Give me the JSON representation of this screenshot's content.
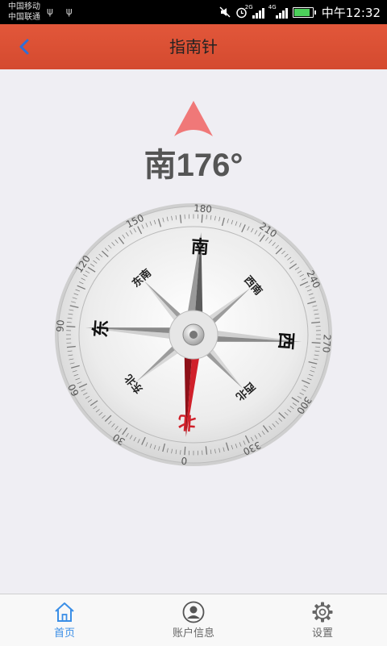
{
  "status_bar": {
    "carrier_1": "中国移动",
    "carrier_2": "中国联通",
    "usb_icons": "ψ ψ",
    "net_1": "2G",
    "net_2": "4G",
    "time": "中午12:32"
  },
  "header": {
    "title": "指南针",
    "back_icon": "chevron-left-icon"
  },
  "heading": {
    "direction": "南",
    "degrees": "176°",
    "arrow_color": "#f07878"
  },
  "compass": {
    "rotation_deg": 176,
    "cardinals": {
      "north": "北",
      "south": "南",
      "east": "东",
      "west": "西"
    },
    "intercardinals": {
      "ne": "东北",
      "se": "东南",
      "sw": "西南",
      "nw": "西北"
    },
    "bearing_labels": [
      "0",
      "30",
      "60",
      "90",
      "120",
      "150",
      "180",
      "210",
      "240",
      "270",
      "300",
      "330"
    ],
    "colors": {
      "north_needle": "#d0202a",
      "north_label": "#d0202a"
    }
  },
  "tabs": [
    {
      "label": "首页",
      "icon": "home-icon",
      "active": true
    },
    {
      "label": "账户信息",
      "icon": "account-icon",
      "active": false
    },
    {
      "label": "设置",
      "icon": "settings-gear-icon",
      "active": false
    }
  ],
  "accent_color": "#3a8ee6"
}
